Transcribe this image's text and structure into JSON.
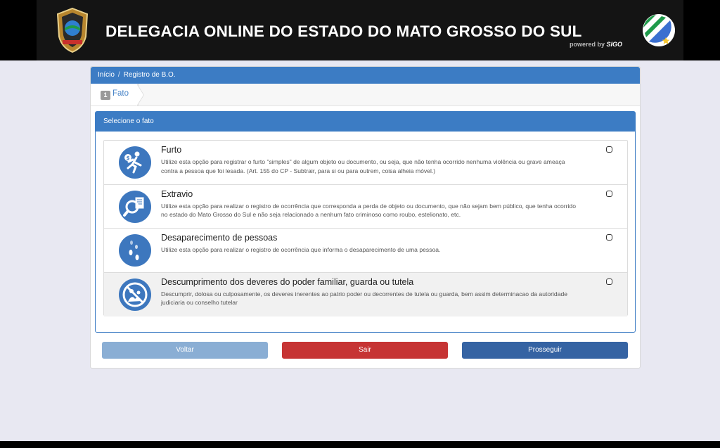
{
  "header": {
    "title": "DELEGACIA ONLINE DO ESTADO DO MATO GROSSO DO SUL",
    "powered_prefix": "powered by",
    "powered_brand": "SIGO",
    "badge_icon": "police-badge-icon",
    "flag_icon": "state-flag-icon"
  },
  "breadcrumb": {
    "home": "Início",
    "separator": "/",
    "current": "Registro de B.O."
  },
  "steps": [
    {
      "number": "1",
      "label": "Fato"
    }
  ],
  "panel": {
    "title": "Selecione o fato",
    "options": [
      {
        "title": "Furto",
        "description": "Utilize esta opção para registrar o furto \"simples\" de algum objeto ou documento, ou seja, que não tenha ocorrido nenhuma violência ou grave ameaça contra a pessoa que foi lesada. (Art. 155 do CP - Subtrair, para si ou para outrem, coisa alheia móvel.)",
        "icon": "thief-running-icon"
      },
      {
        "title": "Extravio",
        "description": "Utilize esta opção para realizar o registro de ocorrência que corresponda a perda de objeto ou documento, que não sejam bem público, que tenha ocorrido no estado do Mato Grosso do Sul e não seja relacionado a nenhum fato criminoso como roubo, estelionato, etc.",
        "icon": "magnifier-document-icon"
      },
      {
        "title": "Desaparecimento de pessoas",
        "description": "Utilize esta opção para realizar o registro de ocorrência que informa o desaparecimento de uma pessoa.",
        "icon": "footprints-icon"
      },
      {
        "title": "Descumprimento dos deveres do poder familiar, guarda ou tutela",
        "description": "Descumprir, dolosa ou culposamente, os deveres inerentes ao patrio poder ou decorrentes de tutela ou guarda, bem assim determinacao da autoridade judiciaria ou conselho tutelar",
        "icon": "family-prohibited-icon"
      }
    ]
  },
  "buttons": {
    "back": "Voltar",
    "exit": "Sair",
    "next": "Prosseguir"
  },
  "colors": {
    "primary": "#3c7cc4",
    "back_button": "#8aaed4",
    "exit_button": "#c63434",
    "next_button": "#3563a3",
    "page_background": "#e8e8f2"
  }
}
